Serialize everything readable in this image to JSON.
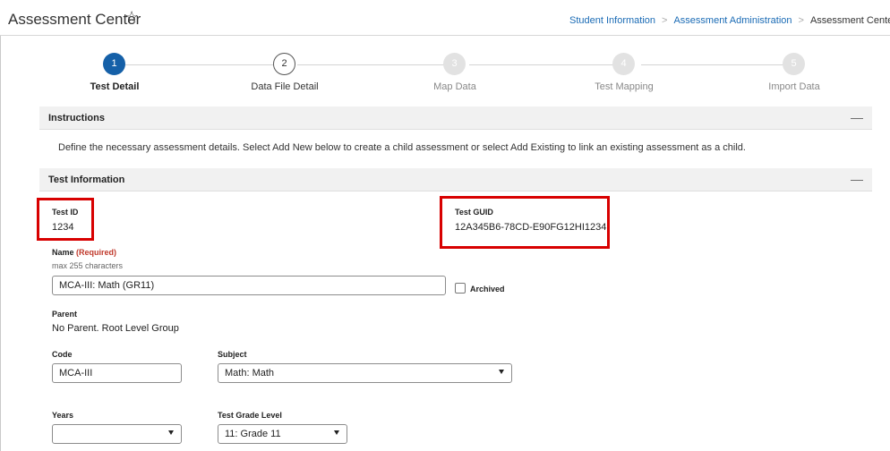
{
  "header": {
    "title": "Assessment Center",
    "star_glyph": "☆",
    "breadcrumb": [
      "Student Information",
      "Assessment Administration",
      "Assessment Center"
    ],
    "separator": ">"
  },
  "stepper": {
    "steps": [
      {
        "number": "1",
        "label": "Test Detail",
        "state": "active"
      },
      {
        "number": "2",
        "label": "Data File Detail",
        "state": "open"
      },
      {
        "number": "3",
        "label": "Map Data",
        "state": "disabled"
      },
      {
        "number": "4",
        "label": "Test Mapping",
        "state": "disabled"
      },
      {
        "number": "5",
        "label": "Import Data",
        "state": "disabled"
      }
    ]
  },
  "instructions": {
    "title": "Instructions",
    "collapse_glyph": "—",
    "text": "Define the necessary assessment details. Select Add New below to create a child assessment or select Add Existing to link an existing assessment as a child."
  },
  "test_information": {
    "title": "Test Information",
    "collapse_glyph": "—",
    "test_id_label": "Test ID",
    "test_id": "1234",
    "test_guid_label": "Test GUID",
    "test_guid": "12A345B6-78CD-E90FG12HI1234",
    "name_label": "Name",
    "name_required": "(Required)",
    "name_hint": "max 255 characters",
    "name_value": "MCA-III: Math (GR11)",
    "archived_label": "Archived",
    "parent_label": "Parent",
    "parent_value": "No Parent. Root Level Group",
    "code_label": "Code",
    "code_value": "MCA-III",
    "subject_label": "Subject",
    "subject_value": "Math: Math",
    "years_label": "Years",
    "years_value": "",
    "grade_label": "Test Grade Level",
    "grade_value": "11: Grade 11"
  },
  "colors": {
    "accent": "#1560a8",
    "link": "#1a6bb5",
    "highlight": "#d80000",
    "required": "#c0392b"
  }
}
